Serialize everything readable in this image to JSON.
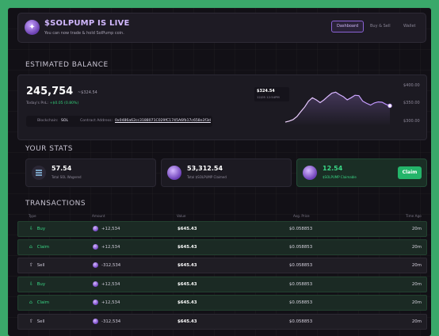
{
  "header": {
    "title": "$SOLPUMP IS LIVE",
    "subtitle": "You can now trade & hold SolPump coin.",
    "nav": [
      "Dashboard",
      "Buy & Sell",
      "Wallet"
    ],
    "active_nav": "Dashboard"
  },
  "balance": {
    "section_title": "ESTIMATED BALANCE",
    "value": "245,754",
    "delta": "~$324.54",
    "pnl_label": "Today's PnL:",
    "pnl_value": "+$0.05 (0.80%)",
    "blockchain_label": "Blockchain:",
    "blockchain_value": "SOL",
    "contract_label": "Contract Address:",
    "contract_value": "0x0486a62cc3188071C029fC1745A6fb17c658e3f3d",
    "tooltip_value": "$324.54",
    "tooltip_date": "12/05 12:54PM",
    "y_labels": [
      "$400.00",
      "$350.00",
      "$300.00"
    ],
    "chart_data": {
      "type": "line",
      "ylim": [
        300,
        400
      ],
      "y_ticks": [
        400,
        350,
        300
      ],
      "values": [
        302,
        305,
        309,
        318,
        332,
        345,
        362,
        372,
        366,
        358,
        366,
        376,
        385,
        388,
        381,
        375,
        366,
        372,
        379,
        378,
        362,
        356,
        351,
        357,
        360,
        359,
        353,
        349
      ]
    },
    "accent": "#c9a4ff"
  },
  "stats": {
    "section_title": "YOUR STATS",
    "items": [
      {
        "value": "57.54",
        "label": "Total SOL Wagered",
        "icon": "solana-icon"
      },
      {
        "value": "53,312.54",
        "label": "Total $SOLPUMP Claimed",
        "icon": "solpump-coin-icon"
      },
      {
        "value": "12.54",
        "label": "$SOLPUMP Claimable",
        "icon": "solpump-coin-icon",
        "button": "Claim"
      }
    ]
  },
  "transactions": {
    "section_title": "TRANSACTIONS",
    "columns": [
      "Type",
      "Amount",
      "Value",
      "Avg. Price",
      "Time Ago"
    ],
    "rows": [
      {
        "type": "Buy",
        "amount": "+12,534",
        "value": "$645.43",
        "price": "$0.058853",
        "ago": "20m"
      },
      {
        "type": "Claim",
        "amount": "+12,534",
        "value": "$645.43",
        "price": "$0.058853",
        "ago": "20m"
      },
      {
        "type": "Sell",
        "amount": "-312,534",
        "value": "$645.43",
        "price": "$0.058853",
        "ago": "20m"
      },
      {
        "type": "Buy",
        "amount": "+12,534",
        "value": "$645.43",
        "price": "$0.058853",
        "ago": "20m"
      },
      {
        "type": "Claim",
        "amount": "+12,534",
        "value": "$645.43",
        "price": "$0.058853",
        "ago": "20m"
      },
      {
        "type": "Sell",
        "amount": "-312,534",
        "value": "$645.43",
        "price": "$0.058853",
        "ago": "20m"
      }
    ]
  },
  "colors": {
    "buy": "#39d685",
    "background": "#121016",
    "frame": "#3aa86a"
  }
}
